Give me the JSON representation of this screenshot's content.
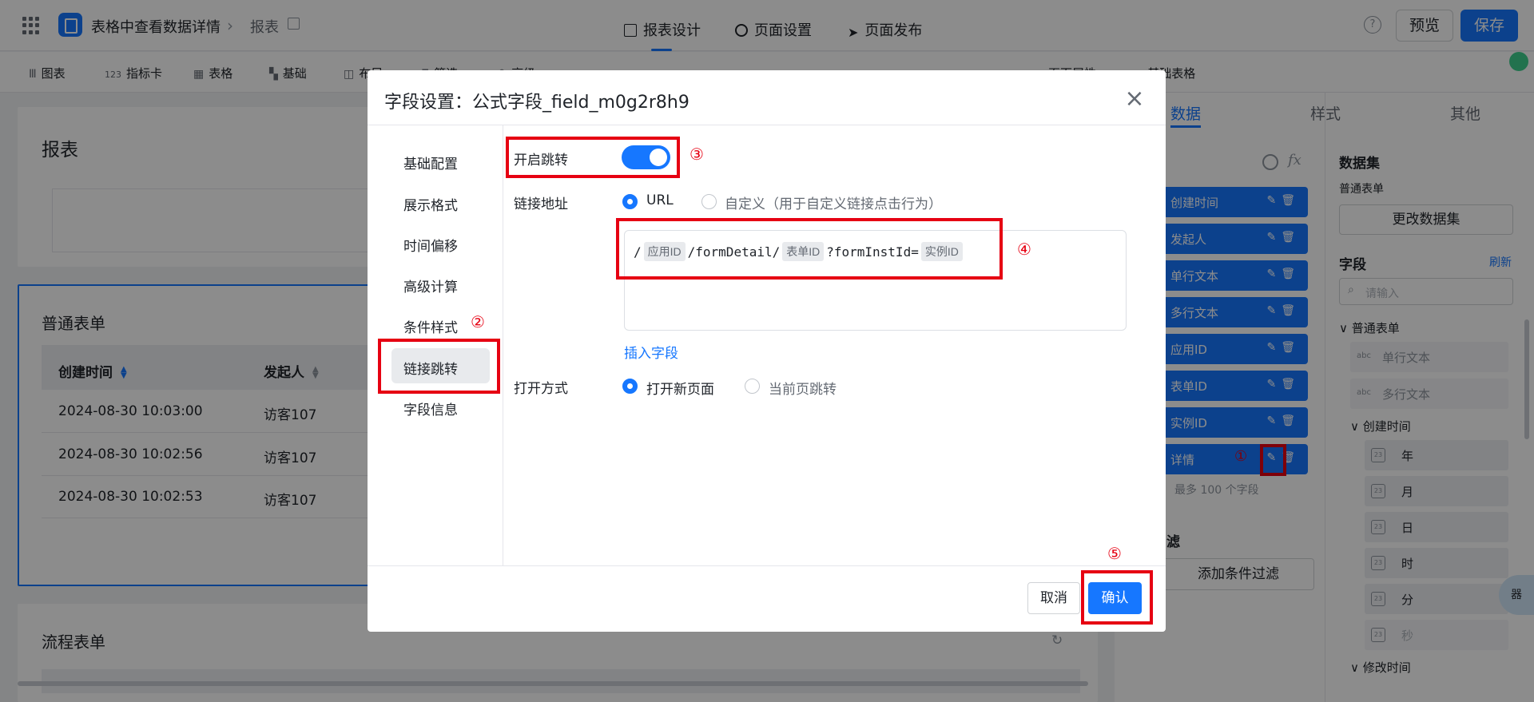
{
  "header": {
    "app_title": "表格中查看数据详情",
    "breadcrumb_sep": "›",
    "page": "报表",
    "tabs": [
      "报表设计",
      "页面设置",
      "页面发布"
    ],
    "preview_label": "预览",
    "save_label": "保存",
    "help_glyph": "?"
  },
  "toolbar": {
    "items": [
      "图表",
      "指标卡",
      "表格",
      "基础",
      "布局",
      "筛选",
      "高级"
    ],
    "chart_glyph": "Ⅲ",
    "indicator_glyph": "123",
    "page_props": "页面属性",
    "base_table": "基础表格"
  },
  "canvas": {
    "report_title": "报表",
    "table1_title": "普通表单",
    "columns": [
      "创建时间",
      "发起人"
    ],
    "rows": [
      [
        "2024-08-30 10:03:00",
        "访客107"
      ],
      [
        "2024-08-30 10:02:56",
        "访客107"
      ],
      [
        "2024-08-30 10:02:53",
        "访客107"
      ]
    ],
    "table2_title": "流程表单"
  },
  "right_panel": {
    "tabs": [
      "数据",
      "样式",
      "其他"
    ],
    "fields": [
      "创建时间",
      "发起人",
      "单行文本",
      "多行文本",
      "应用ID",
      "表单ID",
      "实例ID",
      "详情"
    ],
    "max_fields": "最多 100 个字段",
    "filter_title": "滤",
    "add_filter": "添加条件过滤",
    "dataset_title": "数据集",
    "dataset_name": "普通表单",
    "change_dataset": "更改数据集",
    "field_title": "字段",
    "refresh": "刷新",
    "search_placeholder": "请输入",
    "tree_root": "普通表单",
    "tree_items": [
      "单行文本",
      "多行文本"
    ],
    "tree_type": "abc",
    "created_time": "创建时间",
    "time_parts": [
      "年",
      "月",
      "日",
      "时",
      "分",
      "秒"
    ],
    "modified_time": "修改时间",
    "float_glyph": "器"
  },
  "modal": {
    "title": "字段设置：公式字段_field_m0g2r8h9",
    "close_glyph": "×",
    "nav": [
      "基础配置",
      "展示格式",
      "时间偏移",
      "高级计算",
      "条件样式",
      "链接跳转",
      "字段信息"
    ],
    "active_nav": "链接跳转",
    "enable_jump_label": "开启跳转",
    "link_address_label": "链接地址",
    "link_options": [
      "URL",
      "自定义（用于自定义链接点击行为）"
    ],
    "url_parts": [
      "/",
      "应用ID",
      "/formDetail/",
      "表单ID",
      "?formInstId=",
      "实例ID"
    ],
    "insert_field": "插入字段",
    "open_mode_label": "打开方式",
    "open_options": [
      "打开新页面",
      "当前页跳转"
    ],
    "cancel_label": "取消",
    "confirm_label": "确认"
  },
  "annotations": [
    "①",
    "②",
    "③",
    "④",
    "⑤"
  ],
  "colors": {
    "accent": "#1677ff",
    "annotation": "#e60012",
    "overlay": "rgba(0,0,0,0.45)"
  }
}
